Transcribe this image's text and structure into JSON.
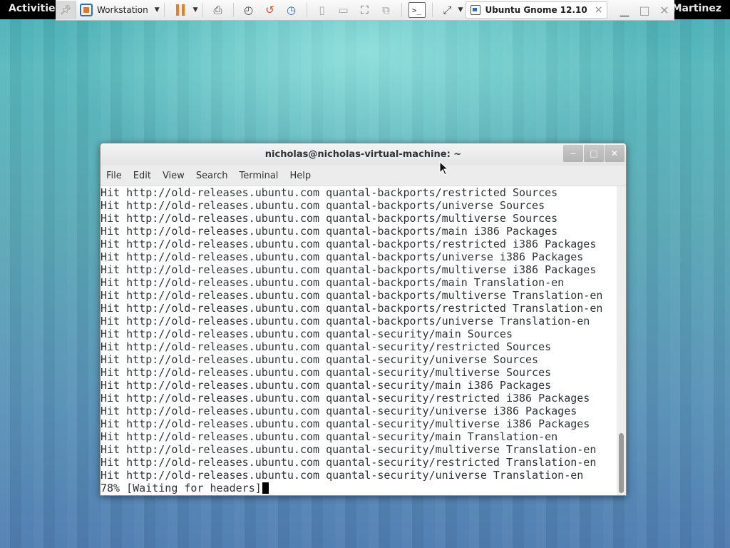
{
  "top_panel": {
    "activities": "Activities",
    "user": "Martinez"
  },
  "vmware_toolbar": {
    "product_label": "Workstation",
    "vm_tab": "Ubuntu Gnome 12.10",
    "tab_close": "×"
  },
  "terminal": {
    "title": "nicholas@nicholas-virtual-machine: ~",
    "menu": [
      "File",
      "Edit",
      "View",
      "Search",
      "Terminal",
      "Help"
    ],
    "lines": [
      "Hit http://old-releases.ubuntu.com quantal-backports/restricted Sources",
      "Hit http://old-releases.ubuntu.com quantal-backports/universe Sources",
      "Hit http://old-releases.ubuntu.com quantal-backports/multiverse Sources",
      "Hit http://old-releases.ubuntu.com quantal-backports/main i386 Packages",
      "Hit http://old-releases.ubuntu.com quantal-backports/restricted i386 Packages",
      "Hit http://old-releases.ubuntu.com quantal-backports/universe i386 Packages",
      "Hit http://old-releases.ubuntu.com quantal-backports/multiverse i386 Packages",
      "Hit http://old-releases.ubuntu.com quantal-backports/main Translation-en",
      "Hit http://old-releases.ubuntu.com quantal-backports/multiverse Translation-en",
      "Hit http://old-releases.ubuntu.com quantal-backports/restricted Translation-en",
      "Hit http://old-releases.ubuntu.com quantal-backports/universe Translation-en",
      "Hit http://old-releases.ubuntu.com quantal-security/main Sources",
      "Hit http://old-releases.ubuntu.com quantal-security/restricted Sources",
      "Hit http://old-releases.ubuntu.com quantal-security/universe Sources",
      "Hit http://old-releases.ubuntu.com quantal-security/multiverse Sources",
      "Hit http://old-releases.ubuntu.com quantal-security/main i386 Packages",
      "Hit http://old-releases.ubuntu.com quantal-security/restricted i386 Packages",
      "Hit http://old-releases.ubuntu.com quantal-security/universe i386 Packages",
      "Hit http://old-releases.ubuntu.com quantal-security/multiverse i386 Packages",
      "Hit http://old-releases.ubuntu.com quantal-security/main Translation-en",
      "Hit http://old-releases.ubuntu.com quantal-security/multiverse Translation-en",
      "Hit http://old-releases.ubuntu.com quantal-security/restricted Translation-en",
      "Hit http://old-releases.ubuntu.com quantal-security/universe Translation-en"
    ],
    "status_line": "78% [Waiting for headers]"
  }
}
